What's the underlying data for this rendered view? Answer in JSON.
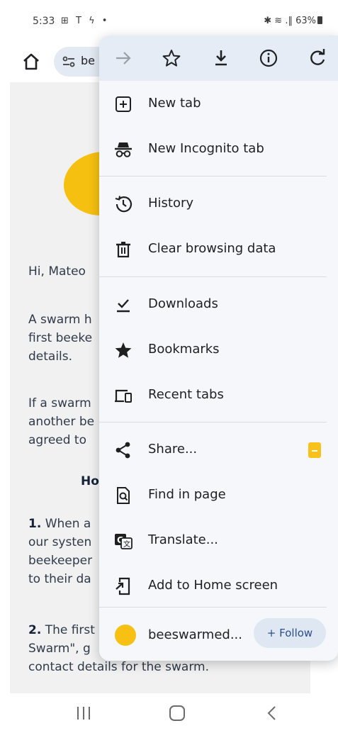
{
  "status_bar": {
    "time": "5:33",
    "left_icons": "⊞ Τ ϟ •",
    "right_text": "✱ ≋ .‖ 63%"
  },
  "toolbar": {
    "url_partial": "be"
  },
  "page": {
    "greeting": "Hi, Mateo",
    "p1": [
      "A swarm h",
      "first beeke",
      "details."
    ],
    "p2": [
      "If a swarm",
      "another be",
      "agreed to"
    ],
    "heading": "Ho",
    "step1_num": "1.",
    "step1": [
      " When a",
      "our systen",
      "beekeeper",
      "to their da"
    ],
    "step2_num": "2.",
    "step2": [
      " The first",
      "Swarm\", g",
      "contact details for the swarm."
    ]
  },
  "menu": {
    "top_actions": [
      "forward-arrow-icon",
      "star-icon",
      "download-icon",
      "info-icon",
      "refresh-icon"
    ],
    "items": {
      "new_tab": "New tab",
      "new_incognito": "New Incognito tab",
      "history": "History",
      "clear_data": "Clear browsing data",
      "downloads": "Downloads",
      "bookmarks": "Bookmarks",
      "recent_tabs": "Recent tabs",
      "share": "Share...",
      "find": "Find in page",
      "translate": "Translate...",
      "add_home": "Add to Home screen"
    },
    "site_name": "beeswarmed...",
    "follow_label": "+ Follow"
  },
  "colors": {
    "menu_bg": "#f5f7fb",
    "menu_top_bg": "#e6ecf5",
    "accent_yellow": "#f5c010",
    "follow_bg": "#dfe7f3"
  }
}
